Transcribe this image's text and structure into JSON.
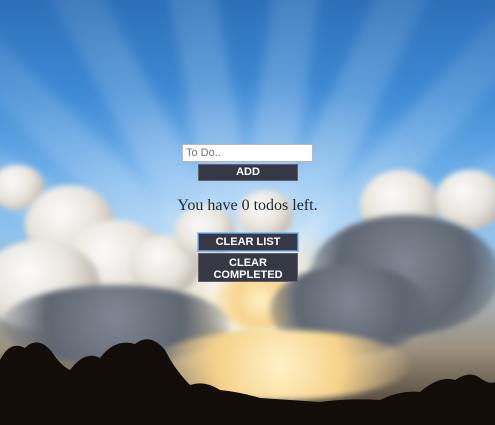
{
  "input": {
    "placeholder": "To Do..",
    "value": ""
  },
  "buttons": {
    "add_label": "ADD",
    "clear_list_label": "CLEAR LIST",
    "clear_completed_label": "CLEAR COMPLETED"
  },
  "status": {
    "text": "You have 0 todos left."
  },
  "colors": {
    "button_bg": "#363845",
    "button_text": "#ffffff",
    "status_text": "#1f2730"
  }
}
